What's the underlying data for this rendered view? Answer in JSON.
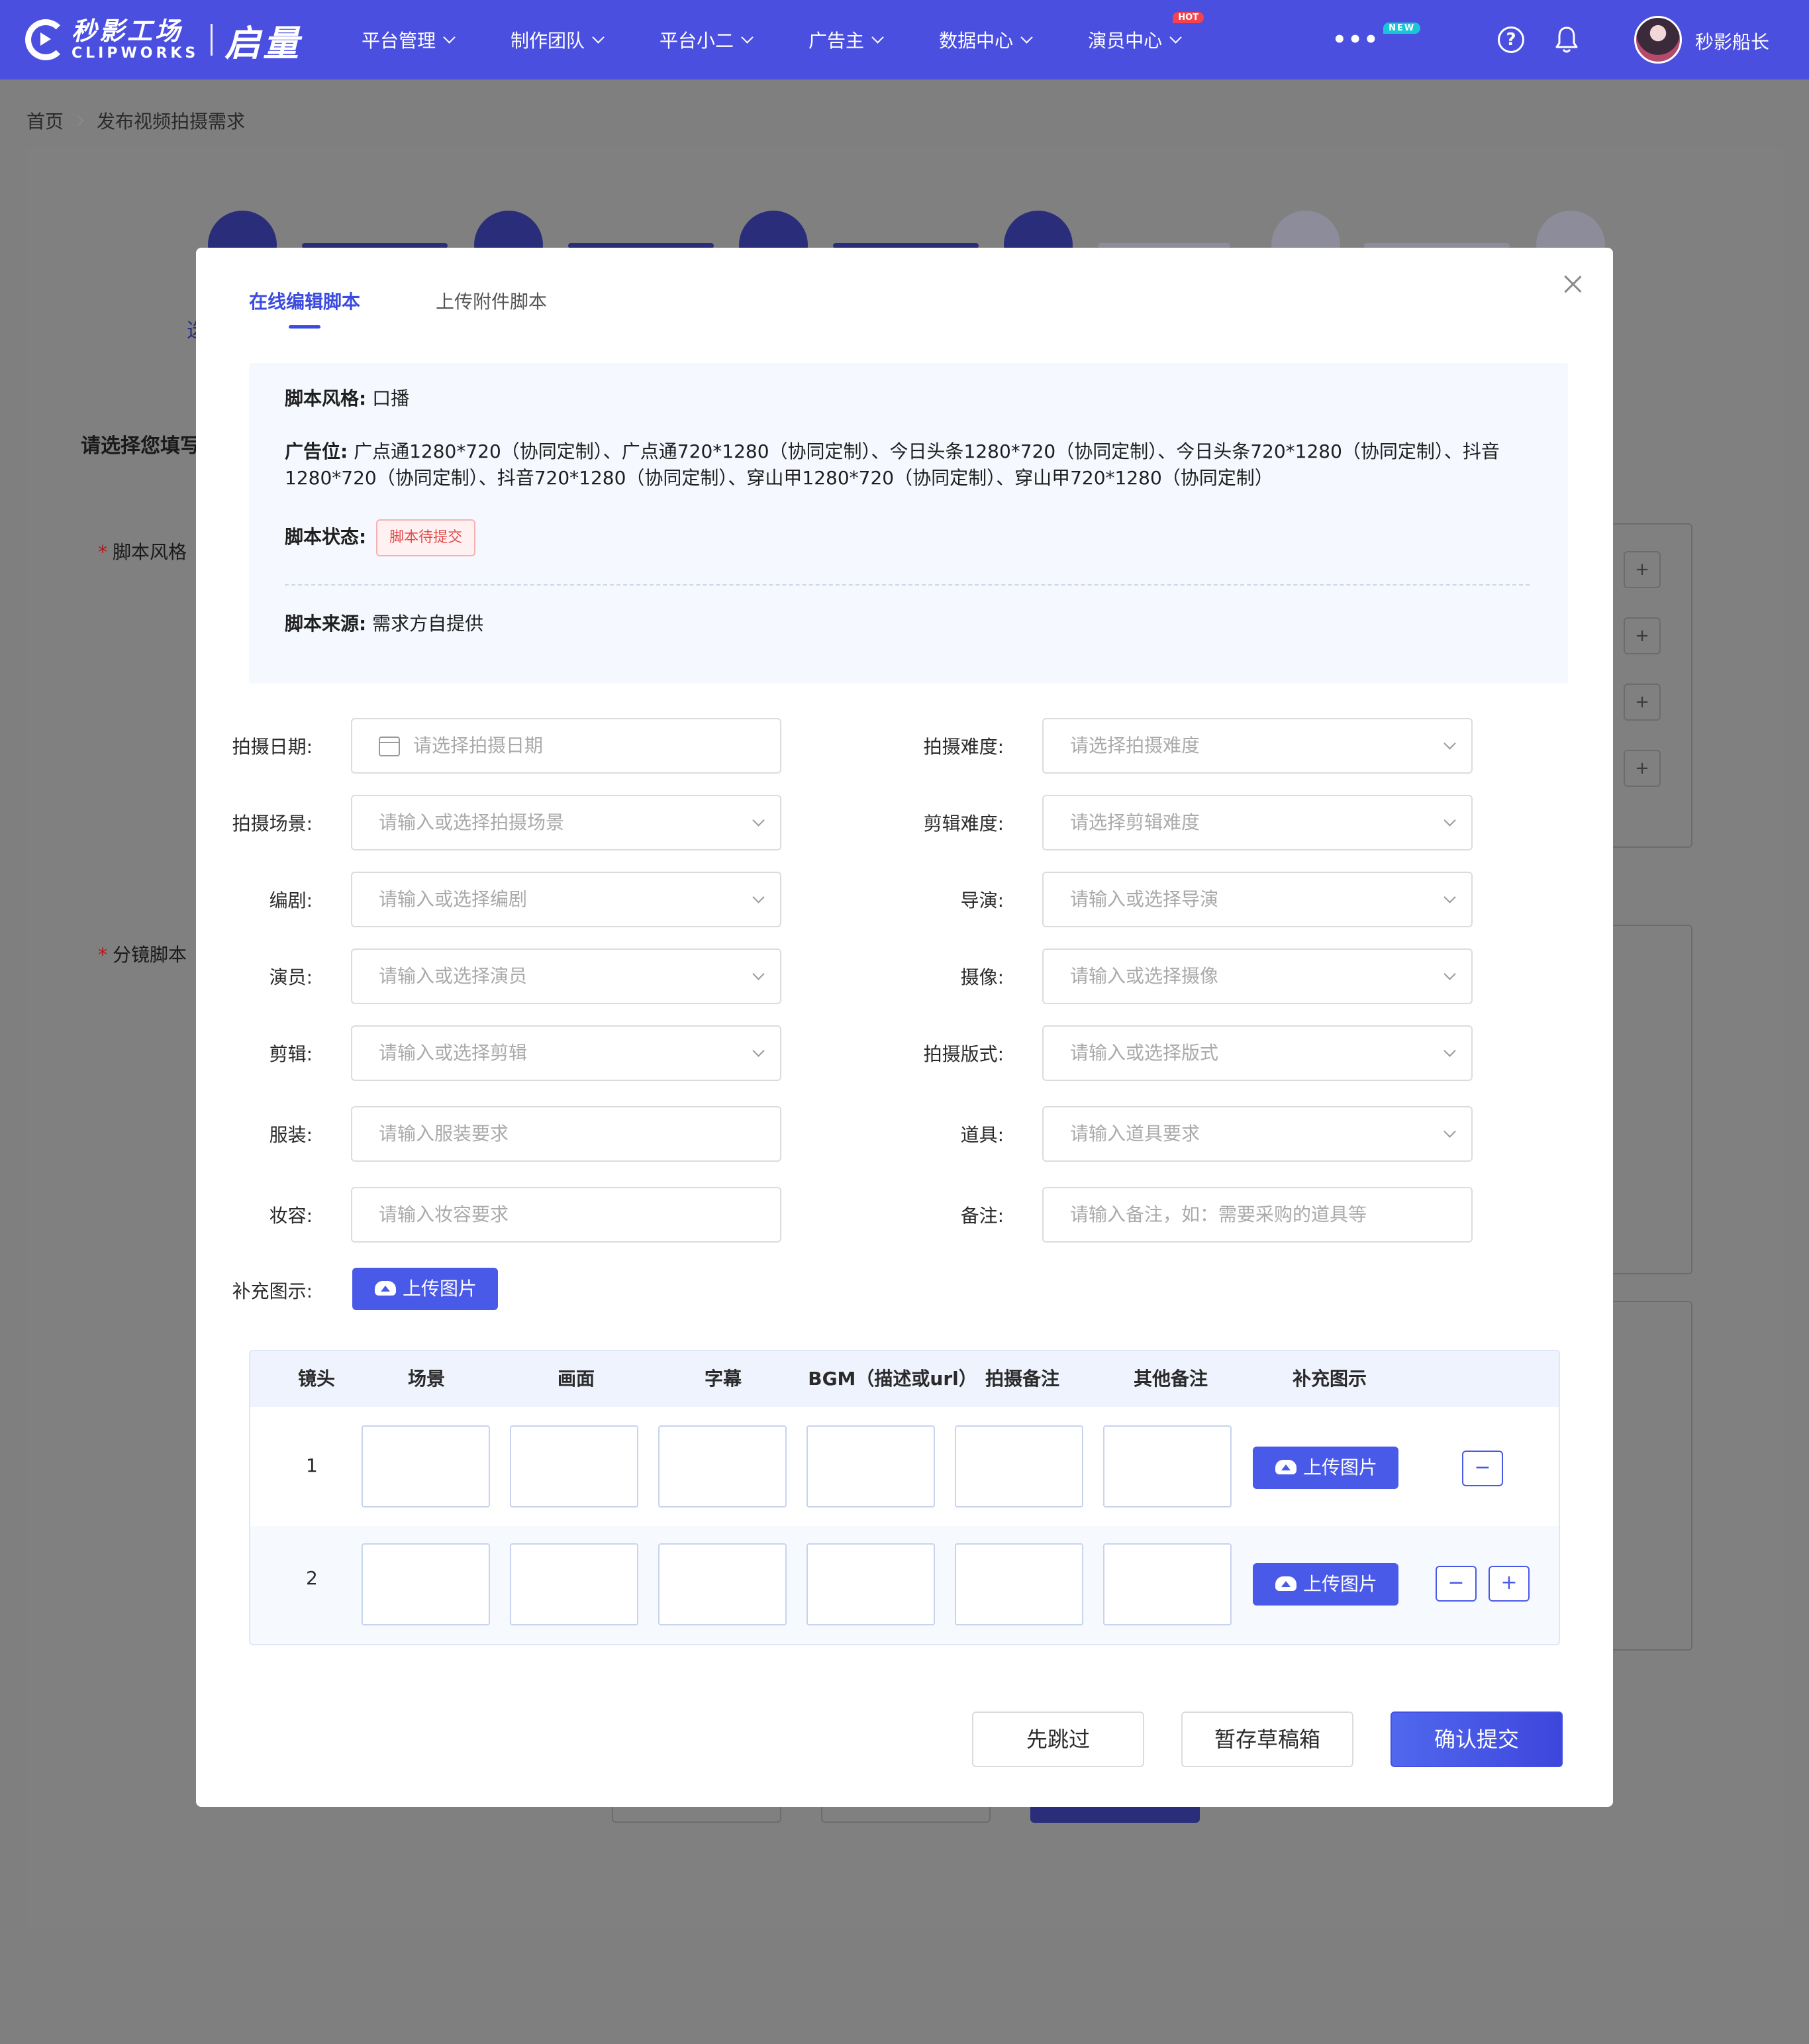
{
  "nav": {
    "logo_cn": "秒影工场",
    "logo_en": "CLIPWORKS",
    "logo_sub": "启量",
    "items": [
      {
        "label": "平台管理",
        "badge": ""
      },
      {
        "label": "制作团队",
        "badge": ""
      },
      {
        "label": "平台小二",
        "badge": ""
      },
      {
        "label": "广告主",
        "badge": ""
      },
      {
        "label": "数据中心",
        "badge": ""
      },
      {
        "label": "演员中心",
        "badge": "HOT"
      }
    ],
    "more_label": "•••",
    "more_badge": "NEW",
    "help_label": "?",
    "user_name": "秒影船长",
    "color_primary": "#4a4fe0"
  },
  "breadcrumb": {
    "home": "首页",
    "current": "发布视频拍摄需求"
  },
  "background_page": {
    "section_title": "请选择您填写",
    "step_label_partial": "选",
    "field_script_style": "脚本风格",
    "field_storyboard": "分镜脚本",
    "plus": "+"
  },
  "modal": {
    "tabs": [
      {
        "label": "在线编辑脚本",
        "active": true
      },
      {
        "label": "上传附件脚本",
        "active": false
      }
    ],
    "info": {
      "style_key": "脚本风格:",
      "style_value": "口播",
      "ad_key": "广告位:",
      "ad_value_line1": "广点通1280*720（协同定制）、广点通720*1280（协同定制）、今日头条1280*720（协同定制）、今日头条720*1280（协同定制）、抖音",
      "ad_value_line2": "1280*720（协同定制）、抖音720*1280（协同定制）、穿山甲1280*720（协同定制）、穿山甲720*1280（协同定制）",
      "status_key": "脚本状态:",
      "status_value": "脚本待提交",
      "source_key": "脚本来源:",
      "source_value": "需求方自提供"
    },
    "form_left": [
      {
        "label": "拍摄日期:",
        "placeholder": "请选择拍摄日期",
        "kind": "date"
      },
      {
        "label": "拍摄场景:",
        "placeholder": "请输入或选择拍摄场景",
        "kind": "select"
      },
      {
        "label": "编剧:",
        "placeholder": "请输入或选择编剧",
        "kind": "select"
      },
      {
        "label": "演员:",
        "placeholder": "请输入或选择演员",
        "kind": "select"
      },
      {
        "label": "剪辑:",
        "placeholder": "请输入或选择剪辑",
        "kind": "select"
      },
      {
        "label": "服装:",
        "placeholder": "请输入服装要求",
        "kind": "input"
      },
      {
        "label": "妆容:",
        "placeholder": "请输入妆容要求",
        "kind": "input"
      }
    ],
    "form_right": [
      {
        "label": "拍摄难度:",
        "placeholder": "请选择拍摄难度",
        "kind": "select"
      },
      {
        "label": "剪辑难度:",
        "placeholder": "请选择剪辑难度",
        "kind": "select"
      },
      {
        "label": "导演:",
        "placeholder": "请输入或选择导演",
        "kind": "select"
      },
      {
        "label": "摄像:",
        "placeholder": "请输入或选择摄像",
        "kind": "select"
      },
      {
        "label": "拍摄版式:",
        "placeholder": "请输入或选择版式",
        "kind": "select"
      },
      {
        "label": "道具:",
        "placeholder": "请输入道具要求",
        "kind": "select"
      },
      {
        "label": "备注:",
        "placeholder": "请输入备注，如：需要采购的道具等",
        "kind": "input"
      }
    ],
    "supplement_label": "补充图示:",
    "upload_label": "上传图片",
    "table": {
      "headers": [
        "镜头",
        "场景",
        "画面",
        "字幕",
        "BGM（描述或url）",
        "拍摄备注",
        "其他备注",
        "补充图示"
      ],
      "rows": [
        {
          "num": "1",
          "upload": "上传图片",
          "controls": [
            "−"
          ]
        },
        {
          "num": "2",
          "upload": "上传图片",
          "controls": [
            "−",
            "+"
          ]
        }
      ]
    },
    "footer": {
      "skip": "先跳过",
      "draft": "暂存草稿箱",
      "submit": "确认提交"
    }
  }
}
